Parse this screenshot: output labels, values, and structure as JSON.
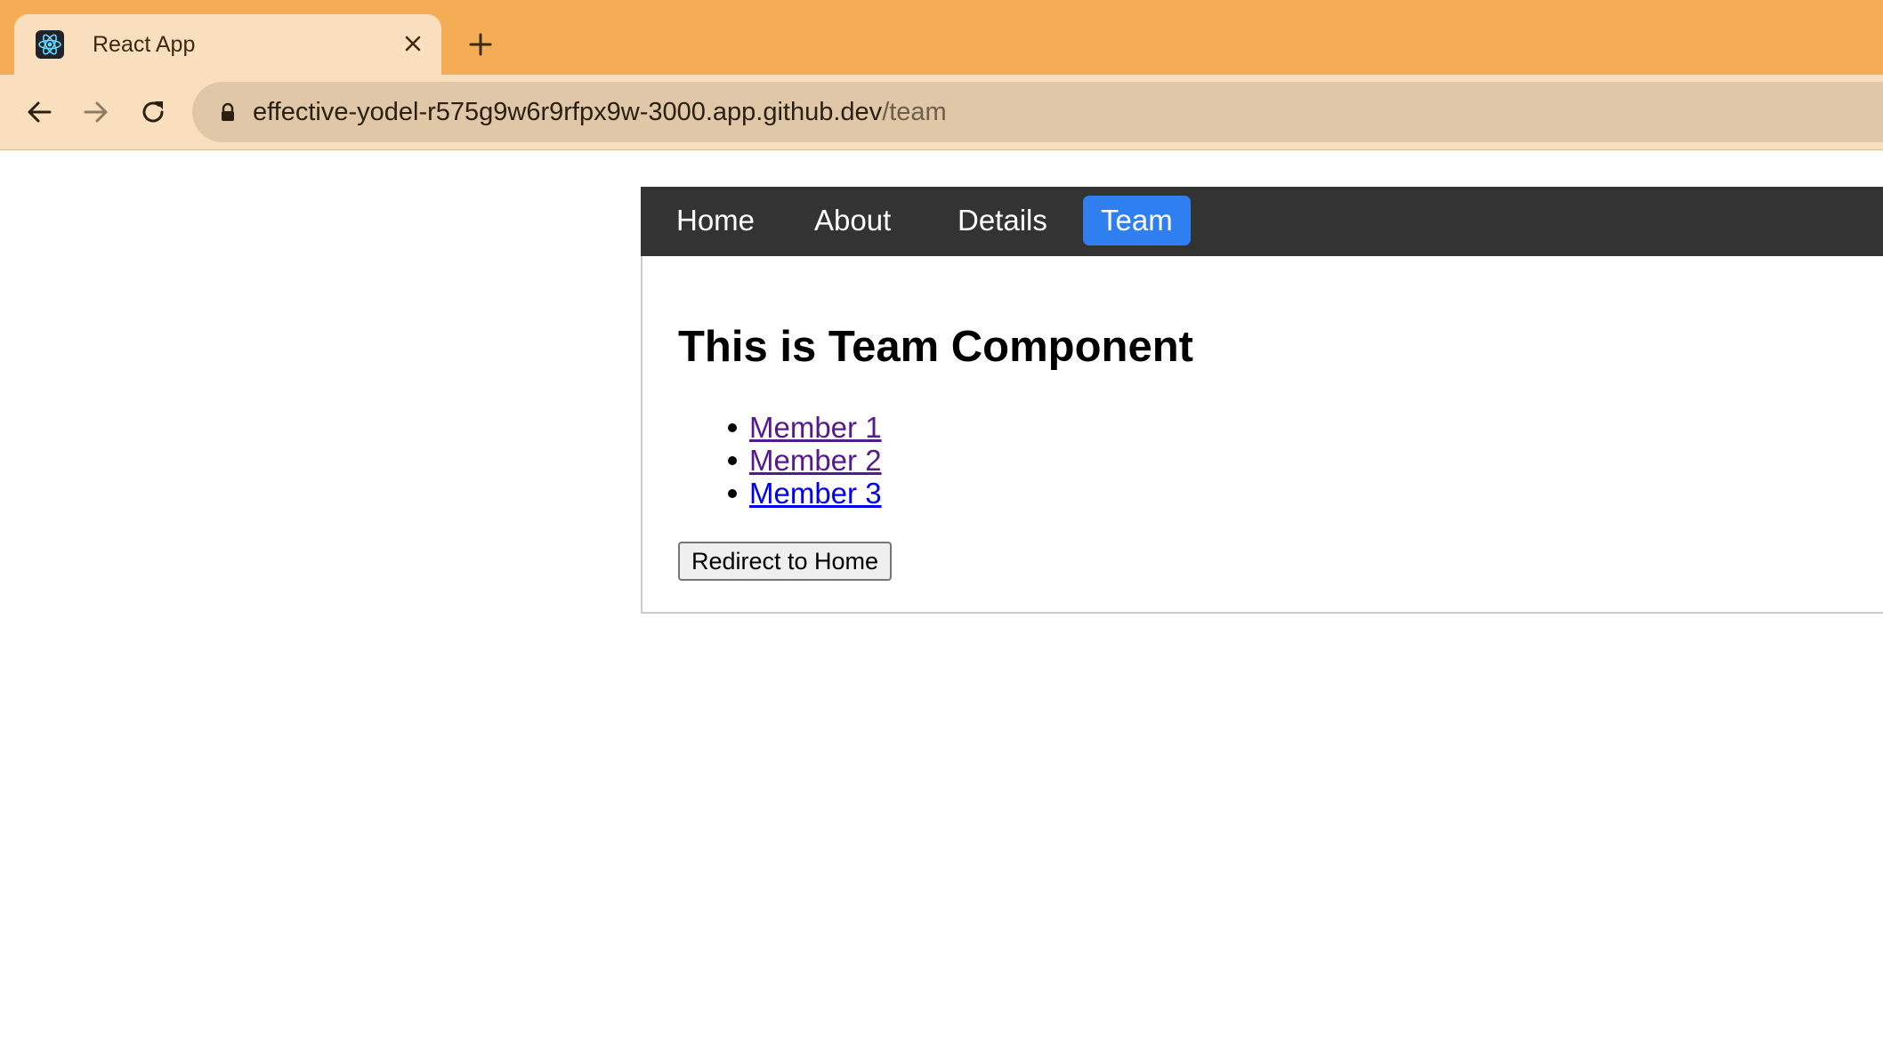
{
  "browser": {
    "tab": {
      "title": "React App",
      "favicon": "react-icon",
      "close_icon": "close-icon"
    },
    "new_tab_icon": "plus-icon",
    "toolbar": {
      "back_icon": "arrow-left-icon",
      "forward_icon": "arrow-right-icon",
      "reload_icon": "reload-icon",
      "lock_icon": "lock-icon",
      "url_host": "effective-yodel-r575g9w6r9rfpx9w-3000.app.github.dev",
      "url_path": "/team"
    },
    "colors": {
      "tabstrip": "#f5ad55",
      "toolbar": "#f9dfbd",
      "omnibox": "#dfc7a8"
    }
  },
  "app": {
    "nav": {
      "items": [
        {
          "label": "Home",
          "active": false
        },
        {
          "label": "About",
          "active": false
        },
        {
          "label": "Details",
          "active": false
        },
        {
          "label": "Team",
          "active": true
        }
      ],
      "background": "#333333",
      "active_color": "#2f7ff0"
    },
    "heading": "This is Team Component",
    "members": [
      {
        "label": "Member 1",
        "visited": true,
        "color": "#551a8b"
      },
      {
        "label": "Member 2",
        "visited": true,
        "color": "#551a8b"
      },
      {
        "label": "Member 3",
        "visited": false,
        "color": "#0000ee"
      }
    ],
    "redirect_button": "Redirect to Home"
  }
}
